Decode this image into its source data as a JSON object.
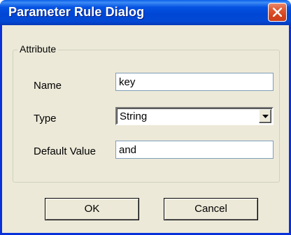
{
  "dialog": {
    "title": "Parameter Rule Dialog",
    "close_icon": "close-x-icon"
  },
  "attribute_group": {
    "legend": "Attribute",
    "name": {
      "label": "Name",
      "value": "key"
    },
    "type": {
      "label": "Type",
      "value": "String",
      "arrow_icon": "dropdown-arrow-icon"
    },
    "default_value": {
      "label": "Default Value",
      "value": "and"
    }
  },
  "buttons": {
    "ok": "OK",
    "cancel": "Cancel"
  },
  "colors": {
    "titlebar": "#0046d5",
    "close_button": "#d5431b",
    "dialog_background": "#ece9d8"
  }
}
